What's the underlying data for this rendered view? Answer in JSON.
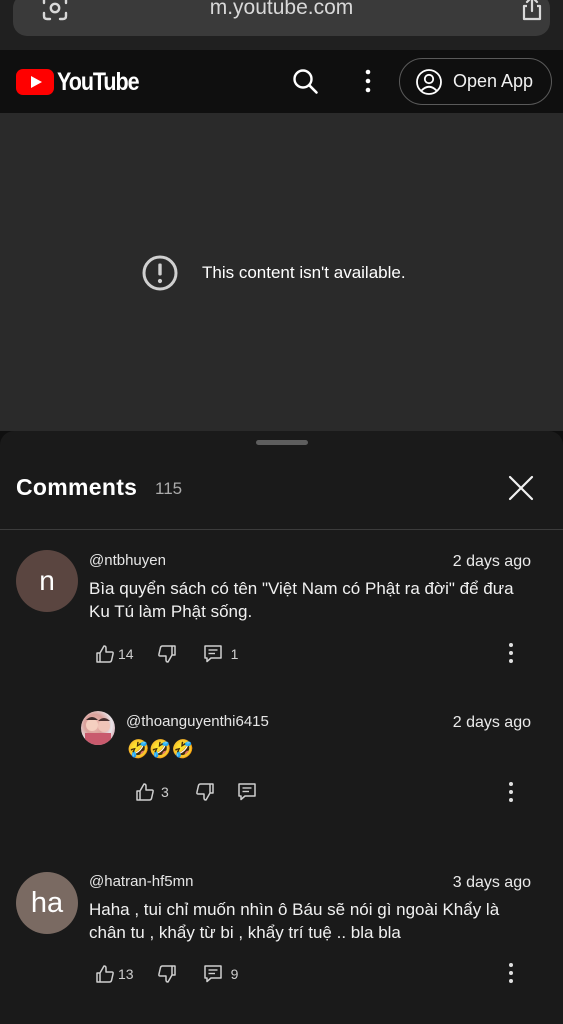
{
  "browser": {
    "url": "m.youtube.com",
    "icons": {
      "lens": "google-lens-icon",
      "share": "share-icon"
    }
  },
  "header": {
    "logo_text": "YouTube",
    "brand_color": "#ff0000",
    "open_app_label": "Open App",
    "icons": {
      "search": "search-icon",
      "more": "more-vertical-icon",
      "account": "account-circle-icon"
    }
  },
  "player": {
    "message": "This content isn't available.",
    "icon": "exclamation-circle-icon"
  },
  "comments": {
    "title": "Comments",
    "count": "115",
    "items": [
      {
        "author": "@ntbhuyen",
        "avatar_letter": "n",
        "avatar_color": "#5a4540",
        "time": "2 days ago",
        "text": "Bìa quyển sách có tên \"Việt Nam có Phật ra đời\" để đưa Ku Tú làm Phật sống.",
        "likes": "14",
        "replies": "1"
      },
      {
        "author": "@thoanguyenthi6415",
        "avatar_letter": "",
        "time": "2 days ago",
        "text": "🤣🤣🤣",
        "likes": "3",
        "replies": ""
      },
      {
        "author": "@hatran-hf5mn",
        "avatar_letter": "ha",
        "avatar_color": "#7a6a62",
        "time": "3 days ago",
        "text": "Haha , tui chỉ muốn nhìn ô Báu sẽ nói gì ngoài Khẩy là chân tu , khẩy từ bi , khẩy trí tuệ ..  bla bla",
        "likes": "13",
        "replies": "9"
      }
    ]
  }
}
